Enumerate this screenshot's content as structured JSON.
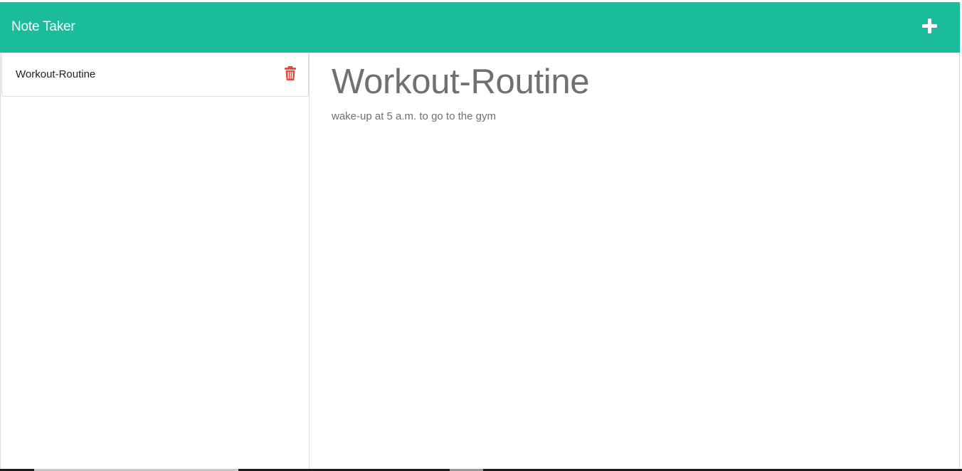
{
  "navbar": {
    "brand": "Note Taker",
    "new_note_icon": "plus-icon",
    "bg_color": "#1abc9c"
  },
  "sidebar": {
    "notes": [
      {
        "title": "Workout-Routine",
        "delete_icon": "trash-icon"
      }
    ],
    "delete_color": "#e74c3c"
  },
  "main": {
    "note_title": "Workout-Routine",
    "note_text": "wake-up at 5 a.m. to go to the gym"
  }
}
